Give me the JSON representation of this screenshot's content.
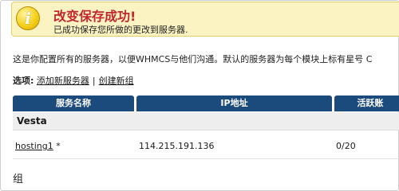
{
  "success": {
    "title": "改变保存成功!",
    "message": "已成功保存您所做的更改到服务器."
  },
  "description": "这是你配置所有的服务器，以便WHMCS与他们沟通。默认的服务器为每个模块上标有星号 C",
  "options": {
    "label": "选项:",
    "add_server": "添加新服务器",
    "separator": "|",
    "create_group": "创建新组"
  },
  "table": {
    "headers": [
      "服务名称",
      "IP地址",
      "活跃账"
    ],
    "group": "Vesta",
    "rows": [
      {
        "name": "hosting1",
        "default_mark": "*",
        "ip": "114.215.191.136",
        "active": "0/20"
      }
    ]
  },
  "footer_label": "组",
  "colors": {
    "header_bg": "#1b4a7c",
    "success_bg": "#fbf3c2",
    "success_title": "#c4262e"
  }
}
